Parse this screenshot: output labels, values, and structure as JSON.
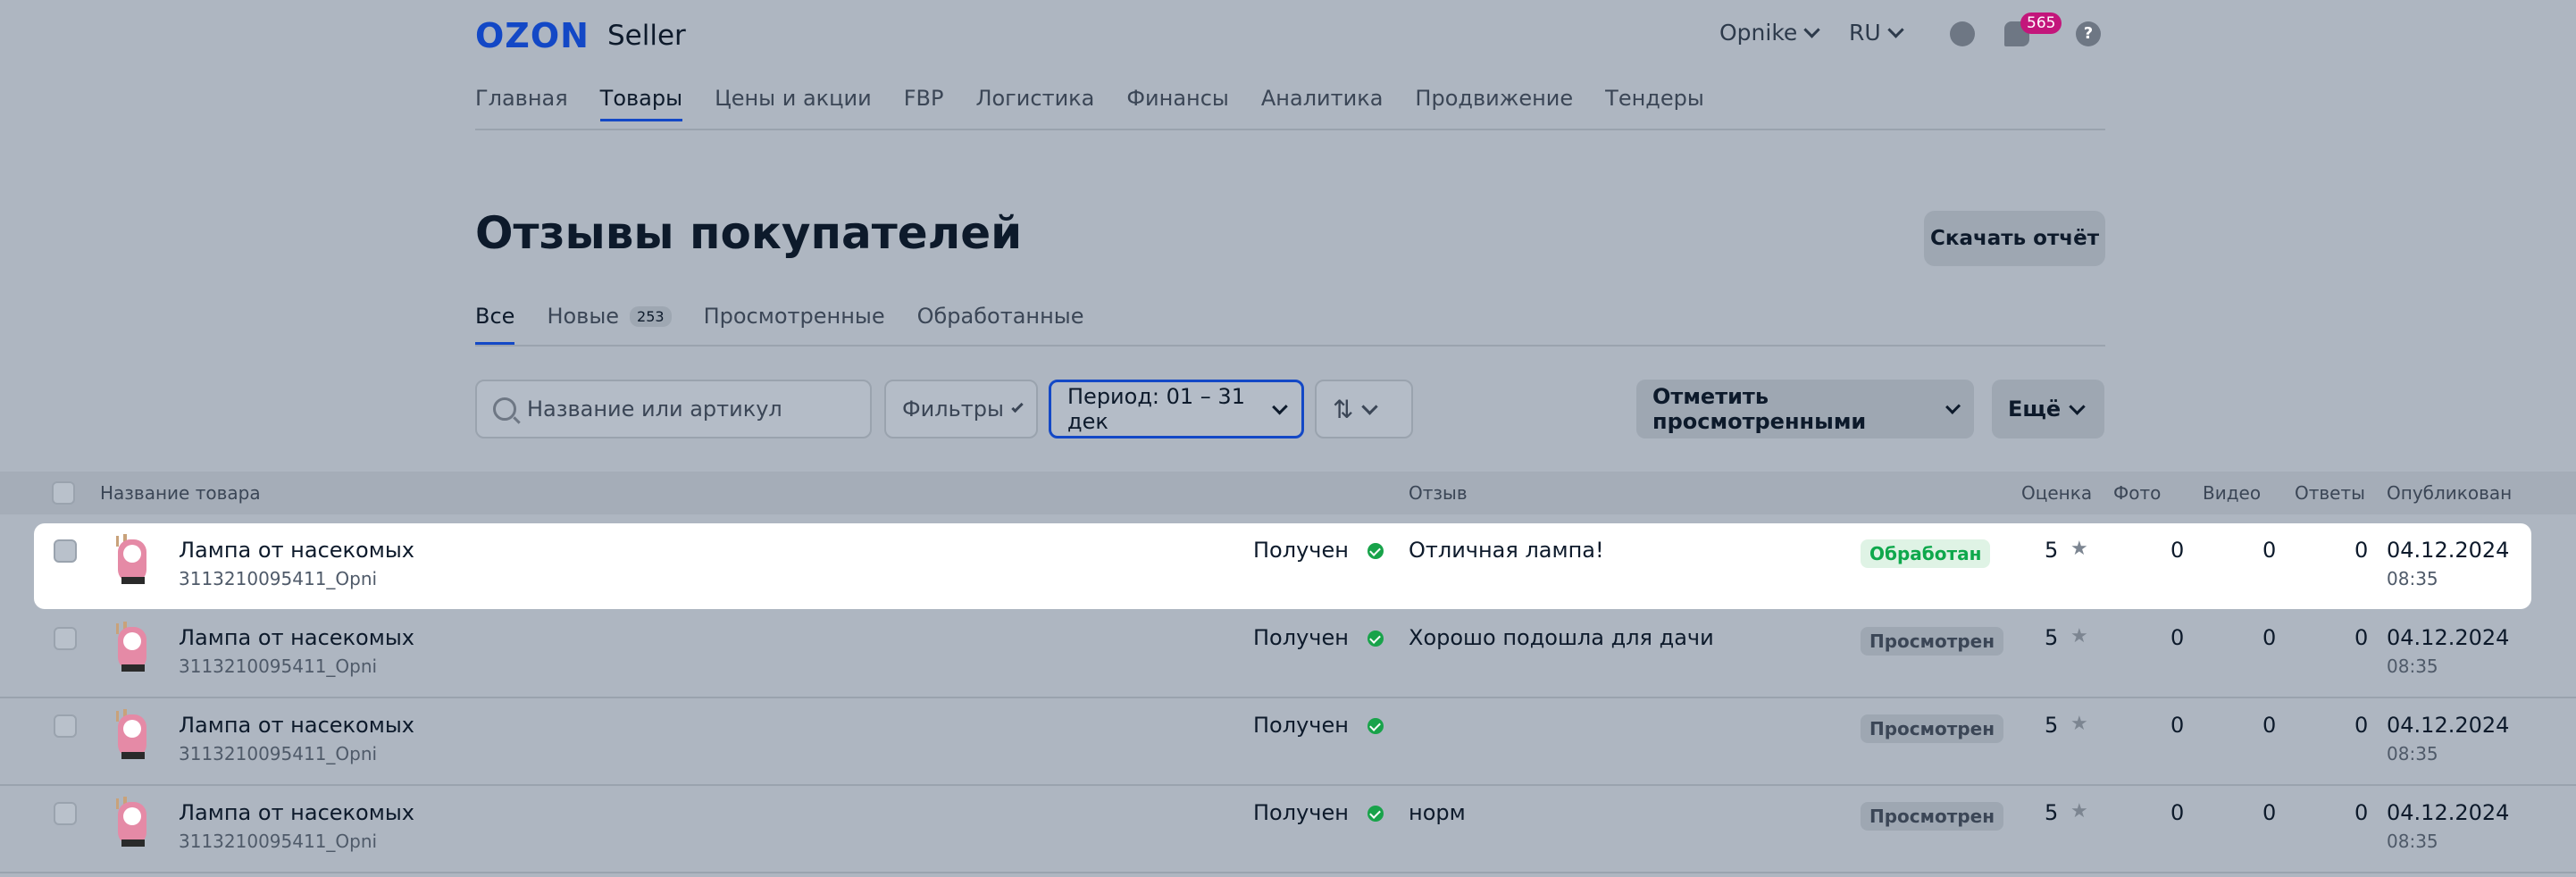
{
  "header": {
    "logo_ozon": "OZON",
    "logo_seller": "Seller",
    "account": "Opnike",
    "language": "RU",
    "messages_count": "565"
  },
  "nav": [
    "Главная",
    "Товары",
    "Цены и акции",
    "FBP",
    "Логистика",
    "Финансы",
    "Аналитика",
    "Продвижение",
    "Тендеры"
  ],
  "page": {
    "title": "Отзывы покупателей",
    "download_button": "Скачать отчёт"
  },
  "tabs": {
    "all": "Все",
    "new": "Новые",
    "new_count": "253",
    "viewed": "Просмотренные",
    "processed": "Обработанные"
  },
  "filters": {
    "search_placeholder": "Название или артикул",
    "filters_label": "Фильтры",
    "period_label": "Период: 01 – 31 дек",
    "mark_viewed": "Отметить просмотренными",
    "more": "Ещё"
  },
  "table": {
    "columns": {
      "product": "Название товара",
      "review": "Отзыв",
      "rating": "Оценка",
      "photo": "Фото",
      "video": "Видео",
      "answers": "Ответы",
      "published": "Опубликован"
    },
    "rows": [
      {
        "name": "Лампа от насекомых",
        "sku": "3113210095411_Opni",
        "status": "Получен",
        "review": "Отличная лампа!",
        "state": "Обработан",
        "rating": "5",
        "photo": "0",
        "video": "0",
        "answers": "0",
        "date": "04.12.2024",
        "time": "08:35"
      },
      {
        "name": "Лампа от насекомых",
        "sku": "3113210095411_Opni",
        "status": "Получен",
        "review": "Хорошо подошла для дачи",
        "state": "Просмотрен",
        "rating": "5",
        "photo": "0",
        "video": "0",
        "answers": "0",
        "date": "04.12.2024",
        "time": "08:35"
      },
      {
        "name": "Лампа от насекомых",
        "sku": "3113210095411_Opni",
        "status": "Получен",
        "review": "",
        "state": "Просмотрен",
        "rating": "5",
        "photo": "0",
        "video": "0",
        "answers": "0",
        "date": "04.12.2024",
        "time": "08:35"
      },
      {
        "name": "Лампа от насекомых",
        "sku": "3113210095411_Opni",
        "status": "Получен",
        "review": "норм",
        "state": "Просмотрен",
        "rating": "5",
        "photo": "0",
        "video": "0",
        "answers": "0",
        "date": "04.12.2024",
        "time": "08:35"
      }
    ]
  },
  "icons": {
    "logo": "ozon-logo",
    "profile": "profile-icon",
    "chat": "chat-icon",
    "help": "help-icon",
    "search": "search-icon",
    "sort": "sort-icon",
    "check": "check-circle-icon",
    "star": "star-icon"
  },
  "colors": {
    "brand": "#1348c6",
    "badge": "#c3167b",
    "success": "#18a34a"
  }
}
